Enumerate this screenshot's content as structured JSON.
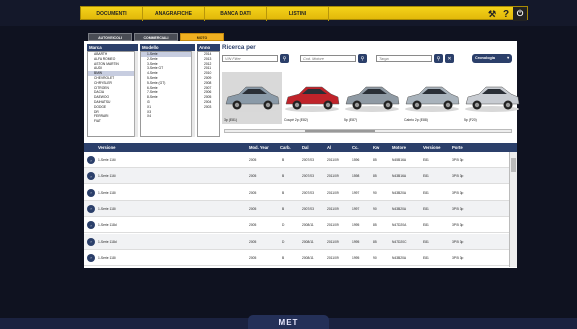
{
  "topbar": {
    "menu": [
      "DOCUMENTI",
      "ANAGRAFICHE",
      "BANCA DATI",
      "LISTINI"
    ],
    "icons": [
      "tools-icon",
      "help-icon",
      "power-icon"
    ],
    "help_label": "?",
    "power_label": "⏻",
    "tools_label": "⚒"
  },
  "tabs": [
    "AUTOVEICOLI",
    "COMMERCIALI",
    "MOTO"
  ],
  "columns": {
    "marca": {
      "label": "Marca",
      "items": [
        "ABARTH",
        "ALFA ROMEO",
        "ASTON MARTIN",
        "AUDI",
        "BMW",
        "CHEVROLET",
        "CHRYSLER",
        "CITROEN",
        "DACIA",
        "DAEWOO",
        "DAIHATSU",
        "DODGE",
        "DR",
        "FERRARI",
        "FIAT"
      ],
      "selected": 4
    },
    "modello": {
      "label": "Modello",
      "items": [
        "1-Serie",
        "2-Serie",
        "3-Serie",
        "3-Serie GT",
        "4-Serie",
        "5-Serie",
        "5-Serie (GT)",
        "6-Serie",
        "7-Serie",
        "8-Serie",
        "i3",
        "X1",
        "X3",
        "X4"
      ],
      "selected": 0
    },
    "anno": {
      "label": "Anno",
      "items": [
        "2014",
        "2013",
        "2012",
        "2011",
        "2010",
        "2009",
        "2008",
        "2007",
        "2006",
        "2005",
        "2004",
        "2003"
      ]
    }
  },
  "ricerca": {
    "title": "Ricerca per",
    "vin_placeholder": "VIN Filter",
    "motore_placeholder": "Cod. Motore",
    "targa_placeholder": "Targa",
    "cronologia": "Cronologia"
  },
  "gallery": [
    {
      "caption": "3p (E81)",
      "color": "#8a9aa8"
    },
    {
      "caption": "Coupè 2p (E82)",
      "color": "#c0232a"
    },
    {
      "caption": "5p (E87)",
      "color": "#8f9aa4"
    },
    {
      "caption": "Cabrio 2p (E88)",
      "color": "#a9b3bc"
    },
    {
      "caption": "5p (F20)",
      "color": "#c8ccd2"
    }
  ],
  "table": {
    "headers": [
      "Versione",
      "Mod. Year",
      "Carb.",
      "Dal",
      "Al",
      "Cc.",
      "Kw",
      "Motore",
      "Versione",
      "Porte"
    ],
    "rows": [
      [
        "1-Serie 116i",
        "2005",
        "B",
        "2007/03",
        "2011/09",
        "1596",
        "85",
        "N45B16A",
        "E81",
        "3P/5 3p"
      ],
      [
        "1-Serie 116i",
        "2005",
        "B",
        "2007/03",
        "2011/09",
        "1598",
        "85",
        "N43B16A",
        "E81",
        "3P/5 3p"
      ],
      [
        "1-Serie 118i",
        "2005",
        "B",
        "2007/03",
        "2011/09",
        "1997",
        "90",
        "N43B20A",
        "E81",
        "3P/5 3p"
      ],
      [
        "1-Serie 118i",
        "2005",
        "B",
        "2007/03",
        "2011/09",
        "1997",
        "90",
        "N43B20A",
        "E81",
        "3P/5 3p"
      ],
      [
        "1-Serie 118d",
        "2005",
        "D",
        "2008/11",
        "2011/09",
        "1995",
        "85",
        "N47D20A",
        "E81",
        "3P/5 3p"
      ],
      [
        "1-Serie 118d",
        "2005",
        "D",
        "2008/11",
        "2011/09",
        "1995",
        "85",
        "N47D20C",
        "E81",
        "3P/5 3p"
      ],
      [
        "1-Serie 118i",
        "2005",
        "B",
        "2008/11",
        "2011/09",
        "1995",
        "90",
        "N43B20A",
        "E81",
        "3P/5 3p"
      ]
    ]
  },
  "footer": {
    "brand": "MET"
  },
  "colors": {
    "accent": "#f4d21a",
    "navy": "#2b3f6a",
    "background": "#0f1220"
  }
}
